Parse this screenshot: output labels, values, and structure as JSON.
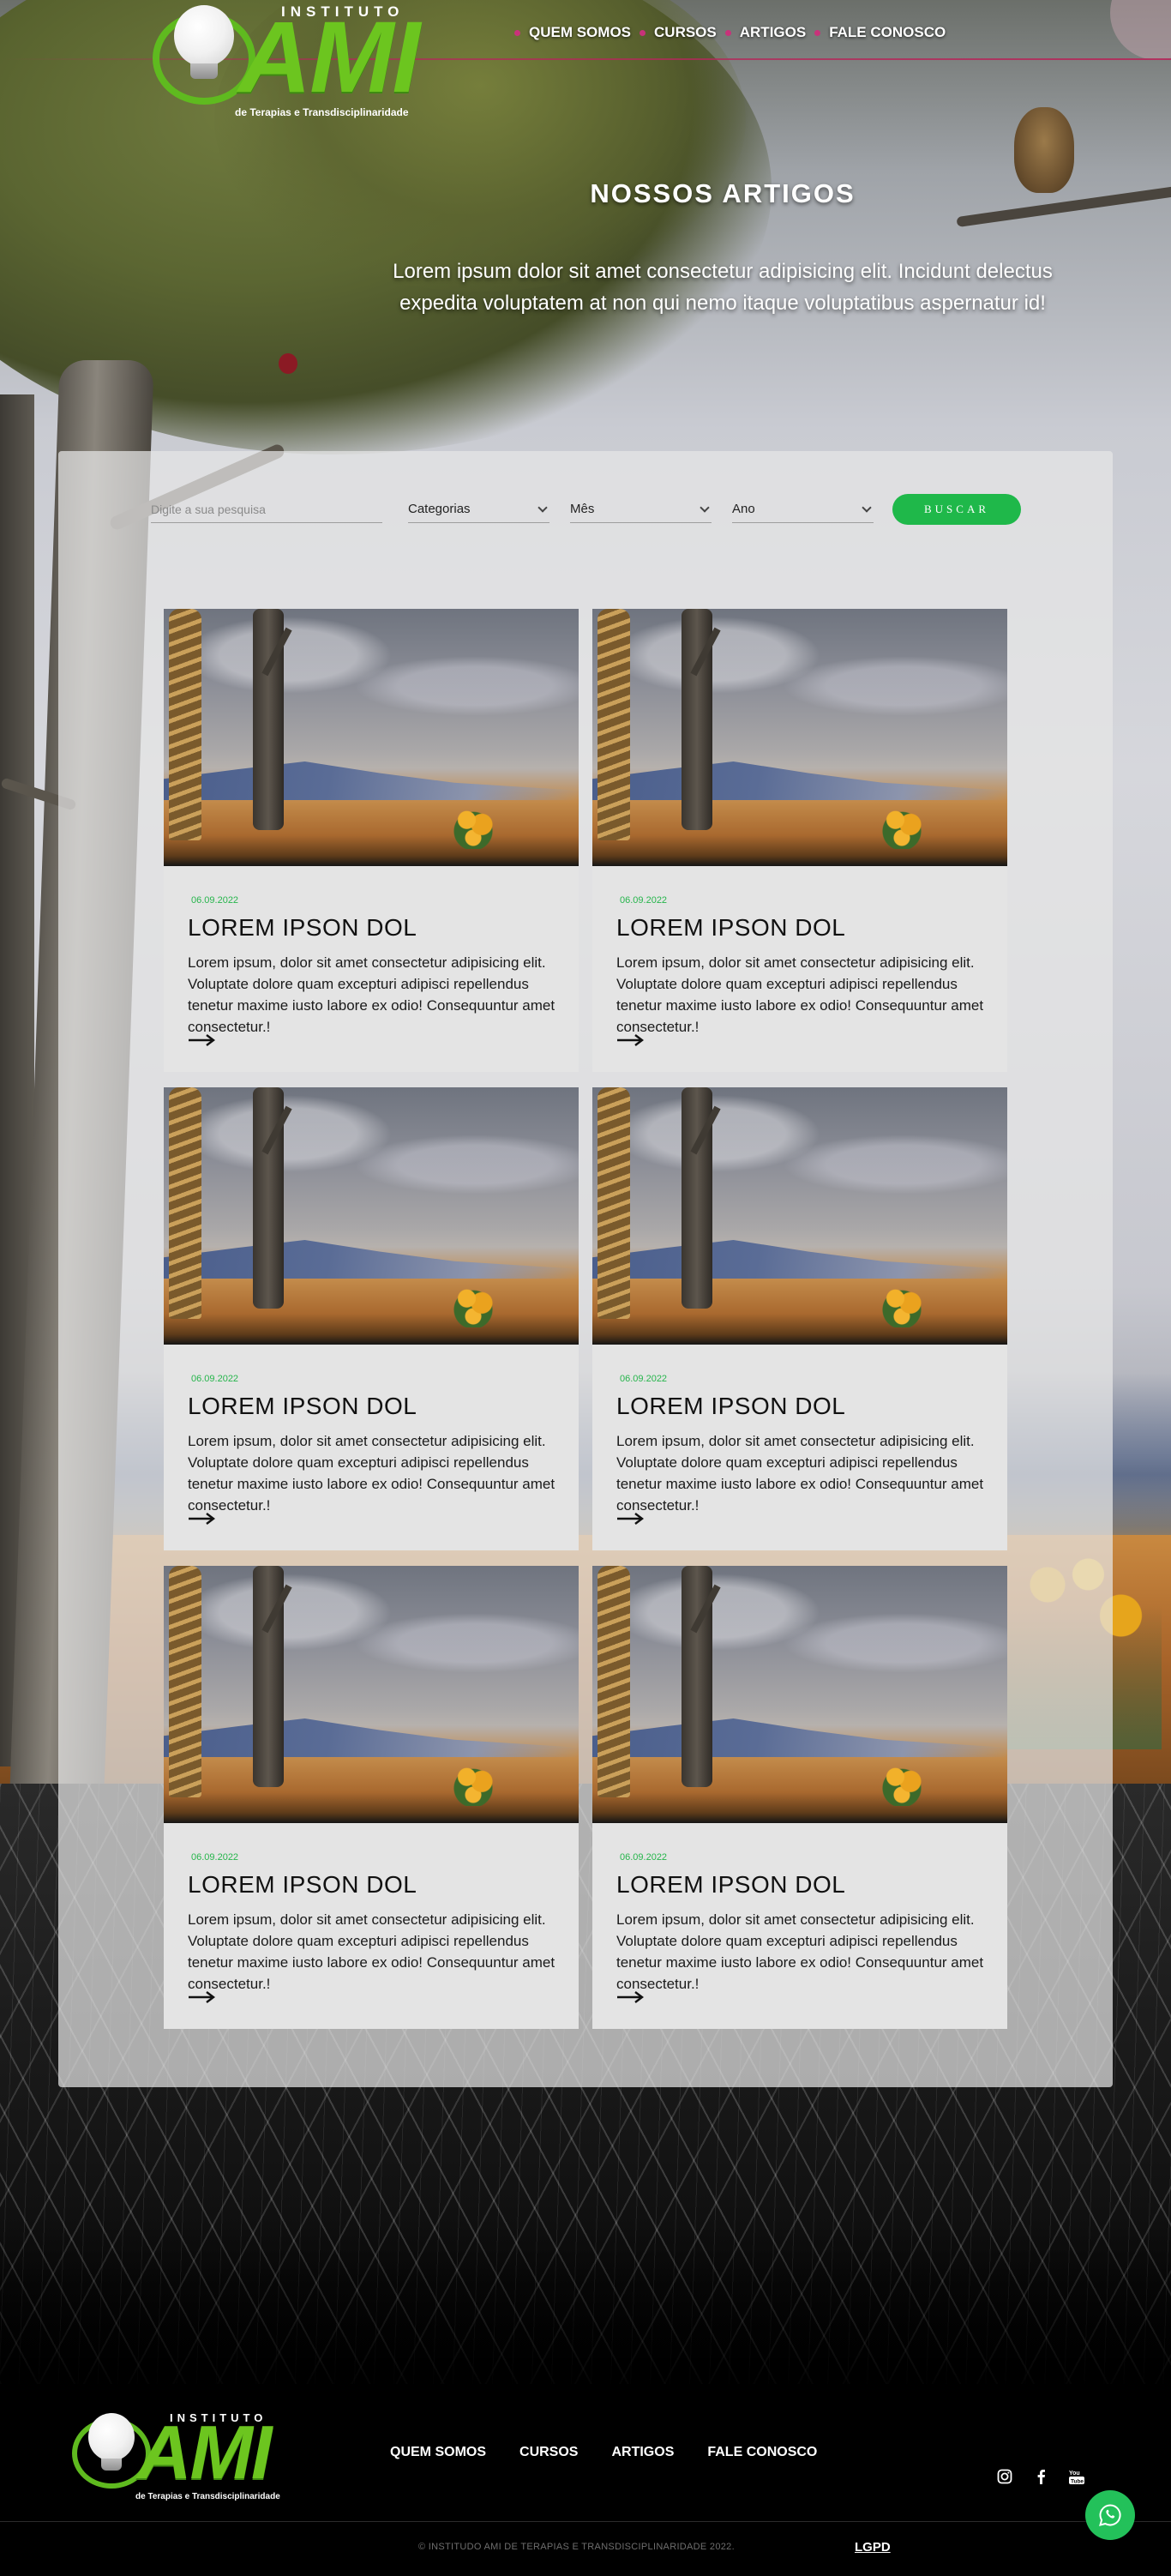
{
  "header": {
    "logo": {
      "instituto": "INSTITUTO",
      "brand": "AMI",
      "tagline": "de Terapias e Transdisciplinaridade"
    },
    "nav": [
      "QUEM SOMOS",
      "CURSOS",
      "ARTIGOS",
      "FALE CONOSCO"
    ]
  },
  "hero": {
    "title": "NOSSOS ARTIGOS",
    "text": "Lorem ipsum dolor sit amet consectetur adipisicing elit. Incidunt delectus expedita voluptatem at non qui nemo itaque voluptatibus aspernatur id!"
  },
  "filters": {
    "search_placeholder": "Digite a sua pesquisa",
    "category": "Categorias",
    "month": "Mês",
    "year": "Ano",
    "button": "BUSCAR"
  },
  "articles": [
    {
      "date": "06.09.2022",
      "title": "LOREM IPSON DOL",
      "excerpt": "Lorem ipsum, dolor sit amet consectetur adipisicing elit. Voluptate dolore quam excepturi adipisci repellendus tenetur maxime iusto labore ex odio! Consequuntur amet consectetur.!"
    },
    {
      "date": "06.09.2022",
      "title": "LOREM IPSON DOL",
      "excerpt": "Lorem ipsum, dolor sit amet consectetur adipisicing elit. Voluptate dolore quam excepturi adipisci repellendus tenetur maxime iusto labore ex odio! Consequuntur amet consectetur.!"
    },
    {
      "date": "06.09.2022",
      "title": "LOREM IPSON DOL",
      "excerpt": "Lorem ipsum, dolor sit amet consectetur adipisicing elit. Voluptate dolore quam excepturi adipisci repellendus tenetur maxime iusto labore ex odio! Consequuntur amet consectetur.!"
    },
    {
      "date": "06.09.2022",
      "title": "LOREM IPSON DOL",
      "excerpt": "Lorem ipsum, dolor sit amet consectetur adipisicing elit. Voluptate dolore quam excepturi adipisci repellendus tenetur maxime iusto labore ex odio! Consequuntur amet consectetur.!"
    },
    {
      "date": "06.09.2022",
      "title": "LOREM IPSON DOL",
      "excerpt": "Lorem ipsum, dolor sit amet consectetur adipisicing elit. Voluptate dolore quam excepturi adipisci repellendus tenetur maxime iusto labore ex odio! Consequuntur amet consectetur.!"
    },
    {
      "date": "06.09.2022",
      "title": "LOREM IPSON DOL",
      "excerpt": "Lorem ipsum, dolor sit amet consectetur adipisicing elit. Voluptate dolore quam excepturi adipisci repellendus tenetur maxime iusto labore ex odio! Consequuntur amet consectetur.!"
    }
  ],
  "footer": {
    "logo": {
      "instituto": "INSTITUTO",
      "brand": "AMI",
      "tagline": "de Terapias e Transdisciplinaridade"
    },
    "nav": [
      "QUEM SOMOS",
      "CURSOS",
      "ARTIGOS",
      "FALE CONOSCO"
    ],
    "social_icons": [
      "instagram-icon",
      "facebook-icon",
      "youtube-icon"
    ],
    "copyright": "© INSTITUDO AMI DE TERAPIAS E TRANSDISCIPLINARIDADE 2022.",
    "lgpd": "LGPD",
    "whatsapp_icon": "whatsapp-icon"
  },
  "colors": {
    "brand_green": "#6cc51f",
    "button_green": "#1fb84a",
    "date_green": "#26b54c",
    "nav_dot": "#c8327a",
    "whatsapp_green": "#23c15a"
  }
}
